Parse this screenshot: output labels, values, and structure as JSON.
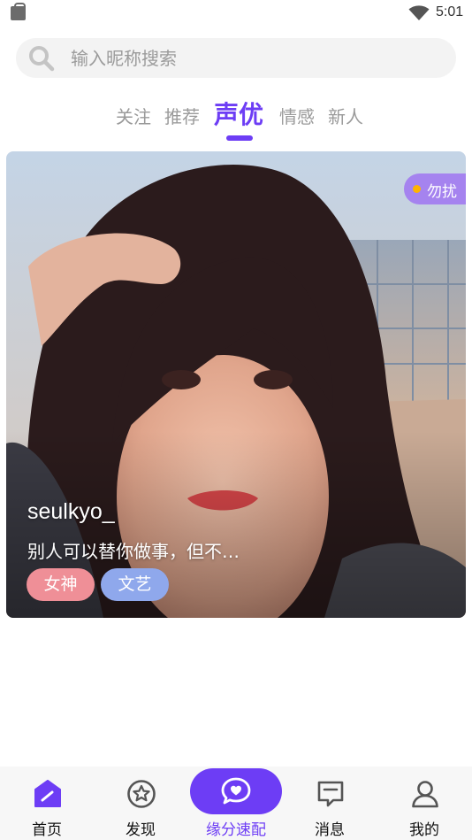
{
  "status_bar": {
    "time": "5:01"
  },
  "search": {
    "placeholder": "输入昵称搜索",
    "value": ""
  },
  "tabs": [
    {
      "label": "关注",
      "active": false
    },
    {
      "label": "推荐",
      "active": false
    },
    {
      "label": "声优",
      "active": true
    },
    {
      "label": "情感",
      "active": false
    },
    {
      "label": "新人",
      "active": false
    }
  ],
  "card": {
    "status": "勿扰",
    "name": "seulkyo_",
    "bio": "别人可以替你做事，但不…",
    "tags": [
      "女神",
      "文艺"
    ]
  },
  "bottom_nav": [
    {
      "label": "首页",
      "icon": "home-icon",
      "active": true
    },
    {
      "label": "发现",
      "icon": "star-badge-icon",
      "active": false
    },
    {
      "label": "缘分速配",
      "icon": "chat-heart-icon",
      "active": false
    },
    {
      "label": "消息",
      "icon": "message-icon",
      "active": false
    },
    {
      "label": "我的",
      "icon": "profile-icon",
      "active": false
    }
  ],
  "colors": {
    "accent": "#6d3df5",
    "tag_pink": "#ef8f97",
    "tag_blue": "#8fa8ec",
    "status_dot": "#ffb300"
  }
}
